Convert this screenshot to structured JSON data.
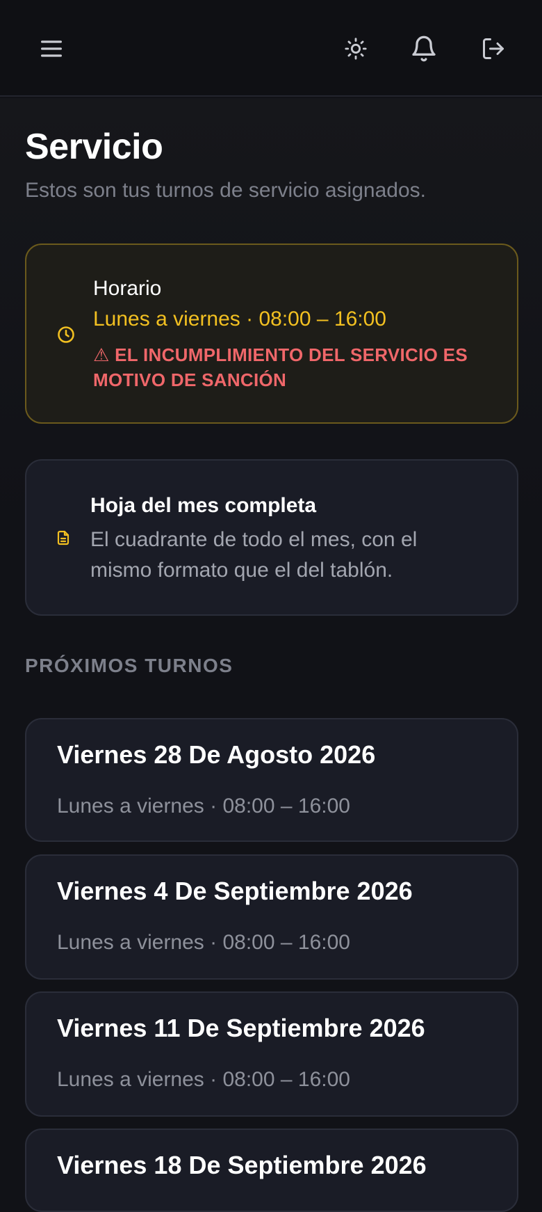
{
  "page": {
    "title": "Servicio",
    "subtitle": "Estos son tus turnos de servicio asignados."
  },
  "topbar": {
    "icons": [
      "menu-icon",
      "sun-icon",
      "bell-icon",
      "logout-icon"
    ]
  },
  "schedule_card": {
    "title": "Horario",
    "time": "Lunes a viernes · 08:00 – 16:00",
    "alert": "⚠ EL INCUMPLIMIENTO DEL SERVICIO ES MOTIVO DE SANCIÓN",
    "icon": "clock-icon"
  },
  "month_sheet_card": {
    "title": "Hoja del mes completa",
    "description": "El cuadrante de todo el mes, con el mismo formato que el del tablón.",
    "icon": "document-icon"
  },
  "upcoming": {
    "label": "PRÓXIMOS TURNOS",
    "shifts": [
      {
        "date": "Viernes 28 De Agosto 2026",
        "time": "Lunes a viernes · 08:00 – 16:00"
      },
      {
        "date": "Viernes 4 De Septiembre 2026",
        "time": "Lunes a viernes · 08:00 – 16:00"
      },
      {
        "date": "Viernes 11 De Septiembre 2026",
        "time": "Lunes a viernes · 08:00 – 16:00"
      },
      {
        "date": "Viernes 18 De Septiembre 2026",
        "time": ""
      }
    ]
  },
  "colors": {
    "accent": "#f2c021",
    "danger": "#f0676a",
    "background": "#111217",
    "card": "#1a1c26"
  }
}
